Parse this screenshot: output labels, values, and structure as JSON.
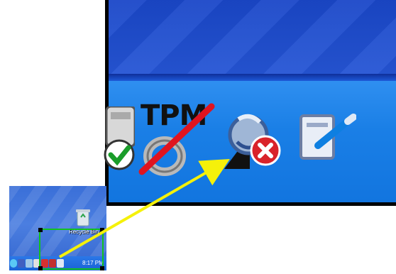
{
  "desktop": {
    "recycle_bin_label": "Recycle Bin",
    "clock": "8:17 PM"
  },
  "zoomed_tray": {
    "tpm_label": "TPM",
    "icons": [
      "safe-icon",
      "tpm-disabled-icon",
      "security-center-warning-icon",
      "note-icon"
    ]
  },
  "colors": {
    "arrow": "#f5f10a",
    "highlight": "#12c21e",
    "taskbar": "#1a7fe6",
    "tpm_slash": "#e0141f",
    "error_badge": "#d9232a"
  }
}
